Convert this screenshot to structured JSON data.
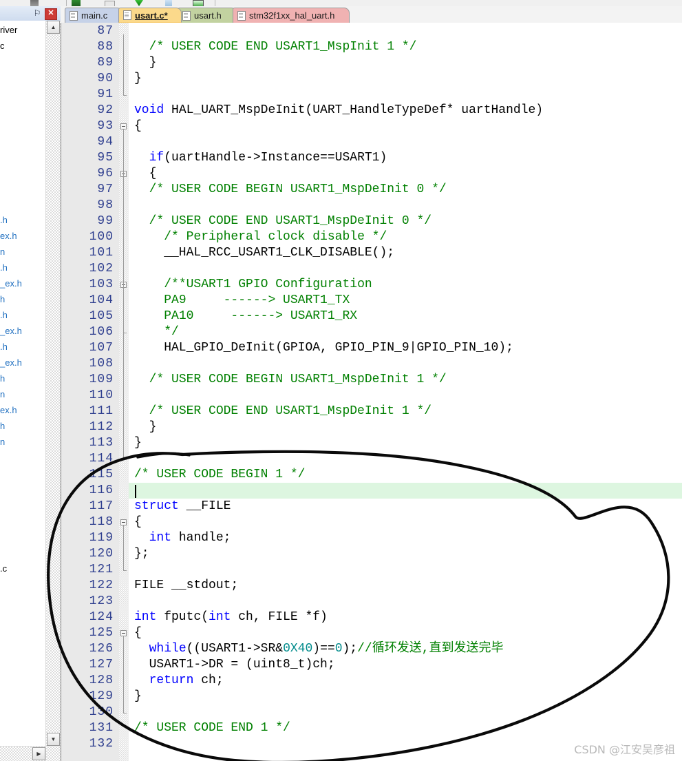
{
  "window": {
    "left_panel": {
      "pin_icon": "⚐",
      "close_label": "✕",
      "tree_items": [
        "river",
        "c",
        "",
        "",
        "",
        "",
        "",
        "",
        "",
        "",
        "",
        "",
        ".h",
        "ex.h",
        "n",
        ".h",
        "_ex.h",
        "h",
        ".h",
        "_ex.h",
        ".h",
        "_ex.h",
        "h",
        "n",
        "ex.h",
        "h",
        "n",
        "",
        "",
        "",
        "",
        "",
        "",
        "",
        ".c"
      ],
      "scroll_up": "▲",
      "scroll_down": "▼",
      "scroll_right": "▶"
    },
    "tabs": [
      {
        "label": "main.c",
        "color": "#c6d2e8",
        "active": false
      },
      {
        "label": "usart.c*",
        "color": "#fbd98b",
        "active": true
      },
      {
        "label": "usart.h",
        "color": "#c2d2a0",
        "active": false
      },
      {
        "label": "stm32f1xx_hal_uart.h",
        "color": "#f0b2b2",
        "active": false
      }
    ],
    "watermark": "CSDN @江安吴彦祖"
  },
  "editor": {
    "highlight_line": 116,
    "colors": {
      "keyword": "#0000ff",
      "comment": "#008000",
      "number": "#008b8b",
      "linenumber": "#2f3f8f",
      "current_line_bg": "#ddf6e0",
      "gutter_bg": "#e9e9e9"
    },
    "lines": [
      {
        "n": 87,
        "tokens": []
      },
      {
        "n": 88,
        "tokens": [
          {
            "t": "  ",
            "c": ""
          },
          {
            "t": "/* USER CODE END USART1_MspInit 1 */",
            "c": "cm"
          }
        ]
      },
      {
        "n": 89,
        "tokens": [
          {
            "t": "  }",
            "c": ""
          }
        ]
      },
      {
        "n": 90,
        "tokens": [
          {
            "t": "}",
            "c": ""
          }
        ]
      },
      {
        "n": 91,
        "tokens": []
      },
      {
        "n": 92,
        "tokens": [
          {
            "t": "void",
            "c": "kw"
          },
          {
            "t": " HAL_UART_MspDeInit(UART_HandleTypeDef* uartHandle)",
            "c": ""
          }
        ]
      },
      {
        "n": 93,
        "tokens": [
          {
            "t": "{",
            "c": ""
          }
        ]
      },
      {
        "n": 94,
        "tokens": []
      },
      {
        "n": 95,
        "tokens": [
          {
            "t": "  ",
            "c": ""
          },
          {
            "t": "if",
            "c": "kw"
          },
          {
            "t": "(uartHandle->Instance==USART1)",
            "c": ""
          }
        ]
      },
      {
        "n": 96,
        "tokens": [
          {
            "t": "  {",
            "c": ""
          }
        ]
      },
      {
        "n": 97,
        "tokens": [
          {
            "t": "  ",
            "c": ""
          },
          {
            "t": "/* USER CODE BEGIN USART1_MspDeInit 0 */",
            "c": "cm"
          }
        ]
      },
      {
        "n": 98,
        "tokens": []
      },
      {
        "n": 99,
        "tokens": [
          {
            "t": "  ",
            "c": ""
          },
          {
            "t": "/* USER CODE END USART1_MspDeInit 0 */",
            "c": "cm"
          }
        ]
      },
      {
        "n": 100,
        "tokens": [
          {
            "t": "    ",
            "c": ""
          },
          {
            "t": "/* Peripheral clock disable */",
            "c": "cm"
          }
        ]
      },
      {
        "n": 101,
        "tokens": [
          {
            "t": "    __HAL_RCC_USART1_CLK_DISABLE();",
            "c": ""
          }
        ]
      },
      {
        "n": 102,
        "tokens": []
      },
      {
        "n": 103,
        "tokens": [
          {
            "t": "    ",
            "c": ""
          },
          {
            "t": "/**USART1 GPIO Configuration",
            "c": "cm"
          }
        ]
      },
      {
        "n": 104,
        "tokens": [
          {
            "t": "    ",
            "c": ""
          },
          {
            "t": "PA9     ------> USART1_TX",
            "c": "cm"
          }
        ]
      },
      {
        "n": 105,
        "tokens": [
          {
            "t": "    ",
            "c": ""
          },
          {
            "t": "PA10     ------> USART1_RX",
            "c": "cm"
          }
        ]
      },
      {
        "n": 106,
        "tokens": [
          {
            "t": "    ",
            "c": ""
          },
          {
            "t": "*/",
            "c": "cm"
          }
        ]
      },
      {
        "n": 107,
        "tokens": [
          {
            "t": "    HAL_GPIO_DeInit(GPIOA, GPIO_PIN_9|GPIO_PIN_10);",
            "c": ""
          }
        ]
      },
      {
        "n": 108,
        "tokens": []
      },
      {
        "n": 109,
        "tokens": [
          {
            "t": "  ",
            "c": ""
          },
          {
            "t": "/* USER CODE BEGIN USART1_MspDeInit 1 */",
            "c": "cm"
          }
        ]
      },
      {
        "n": 110,
        "tokens": []
      },
      {
        "n": 111,
        "tokens": [
          {
            "t": "  ",
            "c": ""
          },
          {
            "t": "/* USER CODE END USART1_MspDeInit 1 */",
            "c": "cm"
          }
        ]
      },
      {
        "n": 112,
        "tokens": [
          {
            "t": "  }",
            "c": ""
          }
        ]
      },
      {
        "n": 113,
        "tokens": [
          {
            "t": "}",
            "c": ""
          }
        ]
      },
      {
        "n": 114,
        "tokens": []
      },
      {
        "n": 115,
        "tokens": [
          {
            "t": "/* USER CODE BEGIN 1 */",
            "c": "cm"
          }
        ]
      },
      {
        "n": 116,
        "tokens": []
      },
      {
        "n": 117,
        "tokens": [
          {
            "t": "struct",
            "c": "kw"
          },
          {
            "t": " __FILE",
            "c": ""
          }
        ]
      },
      {
        "n": 118,
        "tokens": [
          {
            "t": "{",
            "c": ""
          }
        ]
      },
      {
        "n": 119,
        "tokens": [
          {
            "t": "  ",
            "c": ""
          },
          {
            "t": "int",
            "c": "kw"
          },
          {
            "t": " handle;",
            "c": ""
          }
        ]
      },
      {
        "n": 120,
        "tokens": [
          {
            "t": "};",
            "c": ""
          }
        ]
      },
      {
        "n": 121,
        "tokens": []
      },
      {
        "n": 122,
        "tokens": [
          {
            "t": "FILE __stdout;",
            "c": ""
          }
        ]
      },
      {
        "n": 123,
        "tokens": []
      },
      {
        "n": 124,
        "tokens": [
          {
            "t": "int",
            "c": "kw"
          },
          {
            "t": " fputc(",
            "c": ""
          },
          {
            "t": "int",
            "c": "kw"
          },
          {
            "t": " ch, FILE *f)",
            "c": ""
          }
        ]
      },
      {
        "n": 125,
        "tokens": [
          {
            "t": "{",
            "c": ""
          }
        ]
      },
      {
        "n": 126,
        "tokens": [
          {
            "t": "  ",
            "c": ""
          },
          {
            "t": "while",
            "c": "kw"
          },
          {
            "t": "((USART1->SR&",
            "c": ""
          },
          {
            "t": "0X40",
            "c": "num"
          },
          {
            "t": ")==",
            "c": ""
          },
          {
            "t": "0",
            "c": "num"
          },
          {
            "t": ");",
            "c": ""
          },
          {
            "t": "//循环发送,直到发送完毕",
            "c": "cm"
          }
        ]
      },
      {
        "n": 127,
        "tokens": [
          {
            "t": "  USART1->DR = (uint8_t)ch;",
            "c": ""
          }
        ]
      },
      {
        "n": 128,
        "tokens": [
          {
            "t": "  ",
            "c": ""
          },
          {
            "t": "return",
            "c": "kw"
          },
          {
            "t": " ch;",
            "c": ""
          }
        ]
      },
      {
        "n": 129,
        "tokens": [
          {
            "t": "}",
            "c": ""
          }
        ]
      },
      {
        "n": 130,
        "tokens": []
      },
      {
        "n": 131,
        "tokens": [
          {
            "t": "/* USER CODE END 1 */",
            "c": "cm"
          }
        ]
      },
      {
        "n": 132,
        "tokens": []
      }
    ],
    "fold_markers": [
      {
        "line": 93,
        "type": "box"
      },
      {
        "line": 96,
        "type": "box"
      },
      {
        "line": 103,
        "type": "box"
      },
      {
        "line": 118,
        "type": "box"
      },
      {
        "line": 125,
        "type": "box"
      }
    ]
  },
  "annotation": {
    "shape": "hand-drawn-ellipse",
    "stroke": "#000000",
    "description": "hand drawn circle around lines 114-131"
  }
}
